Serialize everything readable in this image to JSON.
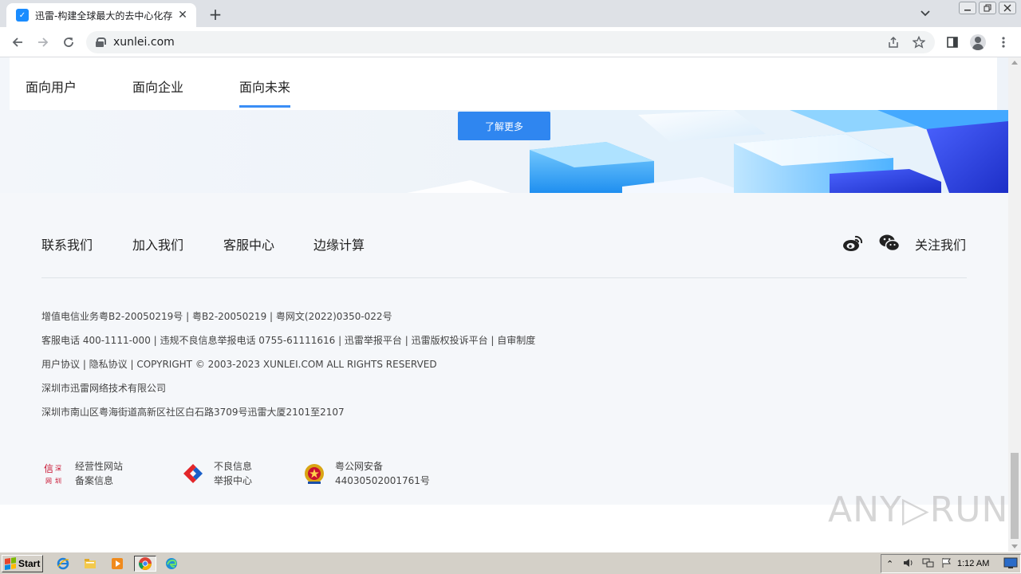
{
  "browser": {
    "tab_title": "迅雷-构建全球最大的去中心化存储与",
    "url": "xunlei.com",
    "new_tab_symbol": "+",
    "close_symbol": "✕"
  },
  "hero": {
    "tabs": [
      "面向用户",
      "面向企业",
      "面向未来"
    ],
    "active_tab_index": 2,
    "learn_more": "了解更多",
    "accent_color": "#2f86f0"
  },
  "footer": {
    "links": [
      "联系我们",
      "加入我们",
      "客服中心",
      "边缘计算"
    ],
    "follow_us": "关注我们",
    "social_icons": [
      "weibo-icon",
      "wechat-icon"
    ],
    "info_lines": [
      "增值电信业务粤B2-20050219号 | 粤B2-20050219 | 粤网文(2022)0350-022号",
      "客服电话 400-1111-000 | 违规不良信息举报电话 0755-61111616 | 迅雷举报平台 | 迅雷版权投诉平台 | 自审制度",
      "用户协议 | 隐私协议 | COPYRIGHT © 2003-2023 XUNLEI.COM ALL RIGHTS RESERVED",
      "深圳市迅雷网络技术有限公司",
      "深圳市南山区粤海街道高新区社区白石路3709号迅雷大厦2101至2107"
    ],
    "badges": [
      {
        "line1": "经营性网站",
        "line2": "备案信息"
      },
      {
        "line1": "不良信息",
        "line2": "举报中心"
      },
      {
        "line1": "粤公网安备",
        "line2": "44030502001761号"
      }
    ]
  },
  "watermark": "ANY▷RUN",
  "taskbar": {
    "start_label": "Start",
    "clock": "1:12 AM"
  }
}
